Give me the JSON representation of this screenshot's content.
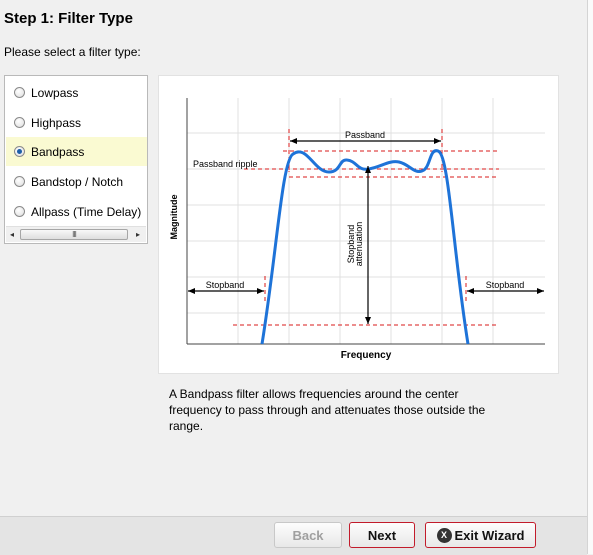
{
  "header": {
    "title": "Step 1: Filter Type",
    "subtitle": "Please select a filter type:"
  },
  "options": [
    {
      "label": "Lowpass",
      "selected": false
    },
    {
      "label": "Highpass",
      "selected": false
    },
    {
      "label": "Bandpass",
      "selected": true
    },
    {
      "label": "Bandstop / Notch",
      "selected": false
    },
    {
      "label": "Allpass (Time Delay)",
      "selected": false
    }
  ],
  "scrollbar": {
    "left_arrow": "◂",
    "right_arrow": "▸",
    "grip": "III"
  },
  "diagram": {
    "passband": "Passband",
    "passband_ripple": "Passband ripple",
    "stopband_left": "Stopband",
    "stopband_right": "Stopband",
    "stopband_attenuation_line1": "Stopband",
    "stopband_attenuation_line2": "attenuation",
    "y_axis": "Magnitude",
    "x_axis": "Frequency",
    "curve_color": "#1e73d8",
    "marker_color": "#d81b1b"
  },
  "description": "A Bandpass filter allows frequencies around the center frequency to pass through and attenuates those outside the range.",
  "buttons": {
    "back": "Back",
    "next": "Next",
    "exit": "Exit Wizard",
    "exit_icon_glyph": "X"
  },
  "colors": {
    "selected_row": "#fafad2",
    "button_accent": "#c21b2b"
  }
}
